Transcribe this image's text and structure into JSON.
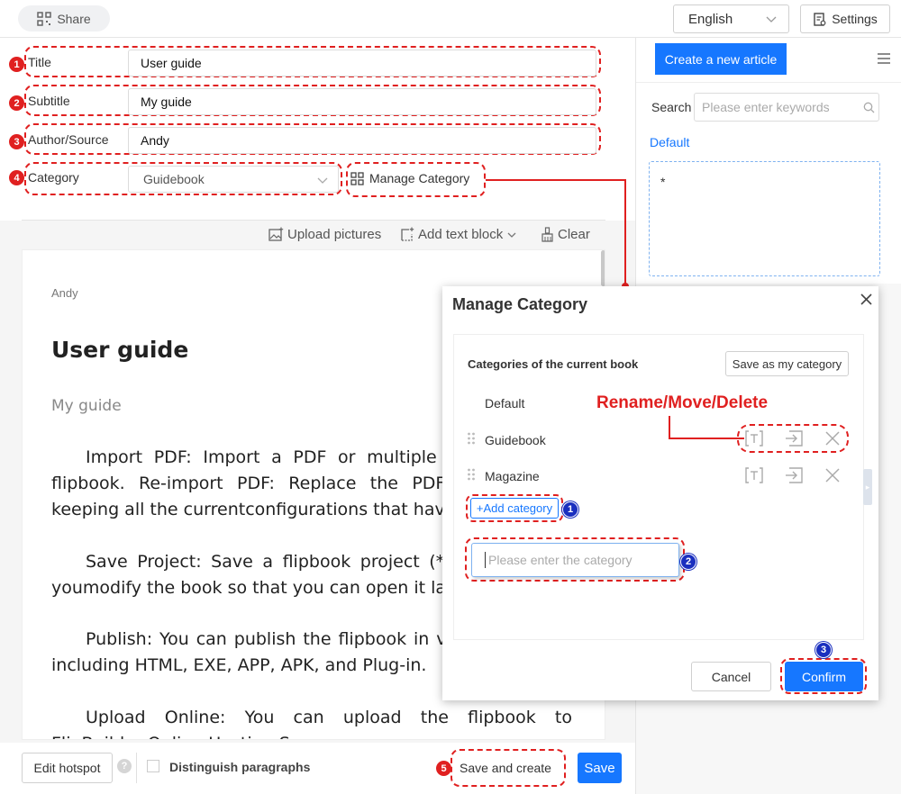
{
  "topbar": {
    "share_label": "Share",
    "language": "English",
    "settings_label": "Settings"
  },
  "form": {
    "title_label": "Title",
    "title_value": "User guide",
    "subtitle_label": "Subtitle",
    "subtitle_value": "My guide",
    "author_label": "Author/Source",
    "author_value": "Andy",
    "category_label": "Category",
    "category_value": "Guidebook",
    "manage_category_label": "Manage Category"
  },
  "badges": {
    "b1": "1",
    "b2": "2",
    "b3": "3",
    "b4": "4",
    "b5": "5",
    "m1": "1",
    "m2": "2",
    "m3": "3"
  },
  "toolbar": {
    "upload_pictures": "Upload pictures",
    "add_text_block": "Add text block",
    "clear": "Clear"
  },
  "editor": {
    "author": "Andy",
    "title": "User guide",
    "subtitle": "My guide",
    "para1": "Import PDF: Import a PDF or multiple PDF files into flipbook. Re-import PDF: Replace the PDF/images while keeping all the currentconfigurations that have been set.",
    "para2": "Save Project: Save a flipbook project (*.flp) whenever youmodify the book so that you can open it later.",
    "para3": "Publish: You can publish the flipbook in various formats including HTML, EXE, APP, APK, and Plug-in.",
    "para4": "Upload Online: You can upload the flipbook to FlipBuilder Online Hosting Server."
  },
  "bottom": {
    "edit_hotspot": "Edit hotspot",
    "distinguish_paragraphs": "Distinguish paragraphs",
    "save_and_create": "Save and create",
    "save": "Save"
  },
  "right": {
    "create_article": "Create a new article",
    "search_label": "Search",
    "search_placeholder": "Please enter keywords",
    "group_default": "Default",
    "article_item": "*"
  },
  "modal": {
    "title": "Manage Category",
    "section_title": "Categories of the current book",
    "save_as_my": "Save as my category",
    "annotation": "Rename/Move/Delete",
    "categories": [
      "Default",
      "Guidebook",
      "Magazine"
    ],
    "add_category": "+Add category",
    "input_placeholder": "Please enter the category",
    "cancel": "Cancel",
    "confirm": "Confirm"
  },
  "colors": {
    "accent": "#1677ff",
    "annotation_red": "#e02020",
    "annotation_blue": "#1a2fbf"
  }
}
